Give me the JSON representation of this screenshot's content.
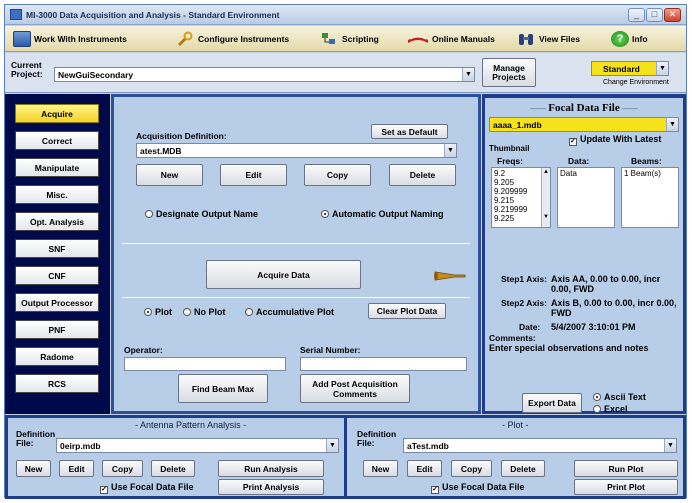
{
  "window": {
    "title": "MI-3000 Data Acquisition and Analysis - Standard Environment",
    "minimize": "_",
    "maximize": "□",
    "close": "✕"
  },
  "menu": [
    {
      "label": "Work With Instruments",
      "icon": "instruments-icon"
    },
    {
      "label": "Configure Instruments",
      "icon": "wrench-icon"
    },
    {
      "label": "Scripting",
      "icon": "scripting-icon"
    },
    {
      "label": "Online Manuals",
      "icon": "book-icon"
    },
    {
      "label": "View Files",
      "icon": "binoculars-icon"
    },
    {
      "label": "Info",
      "icon": "help-icon"
    }
  ],
  "project": {
    "label_1": "Current",
    "label_2": "Project:",
    "value": "NewGuiSecondary",
    "manage_1": "Manage",
    "manage_2": "Projects",
    "env_value": "Standard",
    "env_caption": "Change Environment"
  },
  "sidebar": {
    "items": [
      "Acquire",
      "Correct",
      "Manipulate",
      "Misc.",
      "Opt. Analysis",
      "SNF",
      "CNF",
      "Output Processor",
      "PNF",
      "Radome",
      "RCS"
    ]
  },
  "acquire": {
    "definition_label": "Acquisition Definition:",
    "set_default": "Set as Default",
    "definition_value": "atest.MDB",
    "new": "New",
    "edit": "Edit",
    "copy": "Copy",
    "delete": "Delete",
    "designate": "Designate Output Name",
    "automatic": "Automatic Output Naming",
    "acquire_data": "Acquire Data",
    "plot": "Plot",
    "no_plot": "No Plot",
    "accumulative": "Accumulative Plot",
    "clear_plot": "Clear Plot Data",
    "operator_label": "Operator:",
    "serial_label": "Serial Number:",
    "find_beam": "Find Beam Max",
    "add_comments_1": "Add Post Acquisition",
    "add_comments_2": "Comments"
  },
  "focal": {
    "header": "Focal Data File",
    "file": "aaaa_1.mdb",
    "update": "Update With Latest",
    "thumbnail": "Thumbnail",
    "freqs_label": "Freqs:",
    "data_label": "Data:",
    "beams_label": "Beams:",
    "freqs": [
      "9.2",
      "9.205",
      "9.209999",
      "9.215",
      "9.219999",
      "9.225"
    ],
    "data": [
      "Data"
    ],
    "beams": [
      "1 Beam(s)"
    ],
    "step1_label": "Step1 Axis:",
    "step1_value": "Axis AA, 0.00  to 0.00, incr 0.00, FWD",
    "step2_label": "Step2 Axis:",
    "step2_value": "Axis B, 0.00  to 0.00, incr 0.00, FWD",
    "date_label": "Date:",
    "date_value": "5/4/2007 3:10:01 PM",
    "comments_label": "Comments:",
    "comments_value": "Enter special observations and notes",
    "export": "Export Data",
    "ascii": "Ascii Text",
    "excel": "Excel"
  },
  "antenna": {
    "title": "Antenna Pattern Analysis",
    "def_1": "Definition",
    "def_2": "File:",
    "file": "0eirp.mdb",
    "new": "New",
    "edit": "Edit",
    "copy": "Copy",
    "delete": "Delete",
    "run": "Run Analysis",
    "use_focal": "Use Focal Data File",
    "print": "Print Analysis"
  },
  "plot": {
    "title": "Plot",
    "def_1": "Definition",
    "def_2": "File:",
    "file": "aTest.mdb",
    "new": "New",
    "edit": "Edit",
    "copy": "Copy",
    "delete": "Delete",
    "run": "Run Plot",
    "use_focal": "Use Focal Data File",
    "print": "Print Plot"
  }
}
